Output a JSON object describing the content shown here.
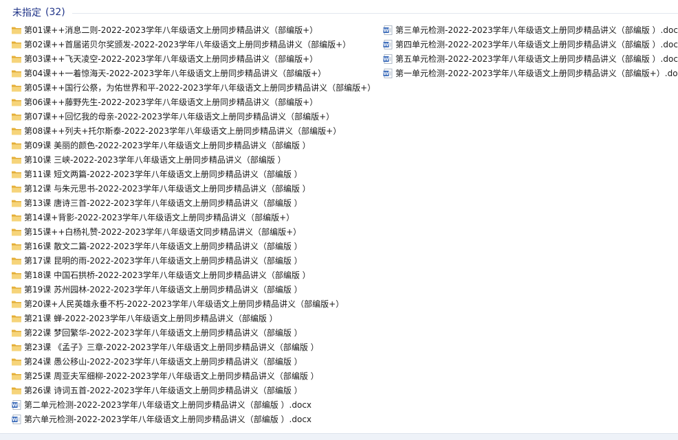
{
  "group": {
    "title": "未指定",
    "count": "(32)"
  },
  "left_items": [
    {
      "type": "folder",
      "name": "第01课++消息二则-2022-2023学年八年级语文上册同步精品讲义（部编版+）"
    },
    {
      "type": "folder",
      "name": "第02课++首届诺贝尔奖颁发-2022-2023学年八年级语文上册同步精品讲义（部编版+）"
    },
    {
      "type": "folder",
      "name": "第03课++飞天凌空-2022-2023学年八年级语文上册同步精品讲义（部编版+）"
    },
    {
      "type": "folder",
      "name": "第04课++一着惊海天-2022-2023学年八年级语文上册同步精品讲义（部编版+）"
    },
    {
      "type": "folder",
      "name": "第05课++国行公祭，为佑世界和平-2022-2023学年八年级语文上册同步精品讲义（部编版+）"
    },
    {
      "type": "folder",
      "name": "第06课++藤野先生-2022-2023学年八年级语文上册同步精品讲义（部编版+）"
    },
    {
      "type": "folder",
      "name": "第07课++回忆我的母亲-2022-2023学年八年级语文上册同步精品讲义（部编版+）"
    },
    {
      "type": "folder",
      "name": "第08课++列夫+托尔斯泰-2022-2023学年八年级语文上册同步精品讲义（部编版+）"
    },
    {
      "type": "folder",
      "name": "第09课  美丽的颜色-2022-2023学年八年级语文上册同步精品讲义（部编版 ）"
    },
    {
      "type": "folder",
      "name": "第10课  三峡-2022-2023学年八年级语文上册同步精品讲义（部编版 ）"
    },
    {
      "type": "folder",
      "name": "第11课 短文两篇-2022-2023学年八年级语文上册同步精品讲义（部编版 ）"
    },
    {
      "type": "folder",
      "name": "第12课 与朱元思书-2022-2023学年八年级语文上册同步精品讲义（部编版 ）"
    },
    {
      "type": "folder",
      "name": "第13课 唐诗三首-2022-2023学年八年级语文上册同步精品讲义（部编版 ）"
    },
    {
      "type": "folder",
      "name": "第14课+背影-2022-2023学年八年级语文上册同步精品讲义（部编版+）"
    },
    {
      "type": "folder",
      "name": "第15课++白杨礼赞-2022-2023学年八年级语文同步精品讲义（部编版+）"
    },
    {
      "type": "folder",
      "name": "第16课  散文二篇-2022-2023学年八年级语文上册同步精品讲义（部编版 ）"
    },
    {
      "type": "folder",
      "name": "第17课  昆明的雨-2022-2023学年八年级语文上册同步精品讲义（部编版 ）"
    },
    {
      "type": "folder",
      "name": "第18课  中国石拱桥-2022-2023学年八年级语文上册同步精品讲义（部编版 ）"
    },
    {
      "type": "folder",
      "name": "第19课 苏州园林-2022-2023学年八年级语文上册同步精品讲义（部编版 ）"
    },
    {
      "type": "folder",
      "name": "第20课+人民英雄永垂不朽-2022-2023学年八年级语文上册同步精品讲义（部编版+）"
    },
    {
      "type": "folder",
      "name": "第21课 蝉-2022-2023学年八年级语文上册同步精品讲义（部编版 ）"
    },
    {
      "type": "folder",
      "name": "第22课 梦回繁华-2022-2023学年八年级语文上册同步精品讲义（部编版 ）"
    },
    {
      "type": "folder",
      "name": "第23课 《孟子》三章-2022-2023学年八年级语文上册同步精品讲义（部编版 ）"
    },
    {
      "type": "folder",
      "name": "第24课 愚公移山-2022-2023学年八年级语文上册同步精品讲义（部编版 ）"
    },
    {
      "type": "folder",
      "name": "第25课  周亚夫军细柳-2022-2023学年八年级语文上册同步精品讲义（部编版 ）"
    },
    {
      "type": "folder",
      "name": "第26课 诗词五首-2022-2023学年八年级语文上册同步精品讲义（部编版 ）"
    },
    {
      "type": "docx",
      "name": "第二单元检测-2022-2023学年八年级语文上册同步精品讲义（部编版 ）.docx"
    },
    {
      "type": "docx",
      "name": "第六单元检测-2022-2023学年八年级语文上册同步精品讲义（部编版 ）.docx"
    }
  ],
  "right_items": [
    {
      "type": "docx",
      "name": "第三单元检测-2022-2023学年八年级语文上册同步精品讲义（部编版 ）.docx"
    },
    {
      "type": "docx",
      "name": "第四单元检测-2022-2023学年八年级语文上册同步精品讲义（部编版 ）.docx"
    },
    {
      "type": "docx",
      "name": "第五单元检测-2022-2023学年八年级语文上册同步精品讲义（部编版 ）.docx"
    },
    {
      "type": "docx",
      "name": "第一单元检测-2022-2023学年八年级语文上册同步精品讲义（部编版+）.docx"
    }
  ],
  "icons": {
    "folder": "folder-icon",
    "docx": "word-document-icon"
  },
  "colors": {
    "group_header": "#1e3287",
    "folder_body": "#e8b23a",
    "folder_front": "#f6d47a",
    "word_blue": "#2b5fb4"
  }
}
